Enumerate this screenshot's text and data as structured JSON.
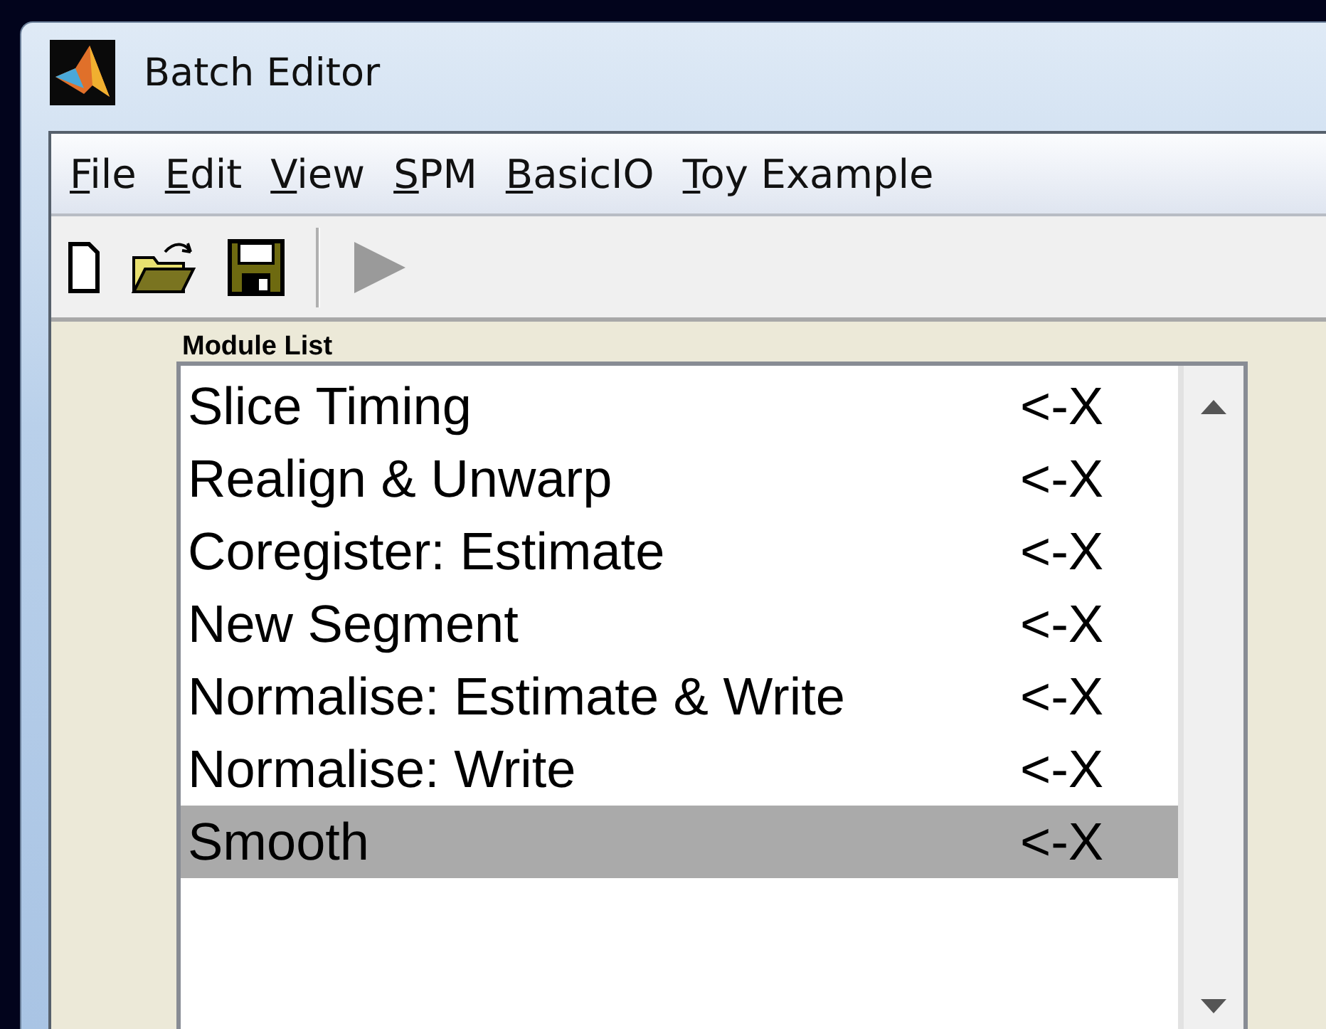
{
  "window": {
    "title": "Batch Editor"
  },
  "menu": [
    {
      "label": "File"
    },
    {
      "label": "Edit"
    },
    {
      "label": "View"
    },
    {
      "label": "SPM"
    },
    {
      "label": "BasicIO"
    },
    {
      "label": "Toy Example"
    }
  ],
  "toolbar": [
    {
      "kind": "new",
      "disabled": false
    },
    {
      "kind": "open",
      "disabled": false
    },
    {
      "kind": "save",
      "disabled": false
    },
    {
      "kind": "separator"
    },
    {
      "kind": "run",
      "disabled": true
    }
  ],
  "module_list": {
    "label": "Module List",
    "items": [
      {
        "name": "Slice Timing",
        "remove": "<-X",
        "selected": false
      },
      {
        "name": "Realign & Unwarp",
        "remove": "<-X",
        "selected": false
      },
      {
        "name": "Coregister: Estimate",
        "remove": "<-X",
        "selected": false
      },
      {
        "name": "New Segment",
        "remove": "<-X",
        "selected": false
      },
      {
        "name": "Normalise: Estimate & Write",
        "remove": "<-X",
        "selected": false
      },
      {
        "name": "Normalise: Write",
        "remove": "<-X",
        "selected": false
      },
      {
        "name": "Smooth",
        "remove": "<-X",
        "selected": true
      }
    ]
  }
}
